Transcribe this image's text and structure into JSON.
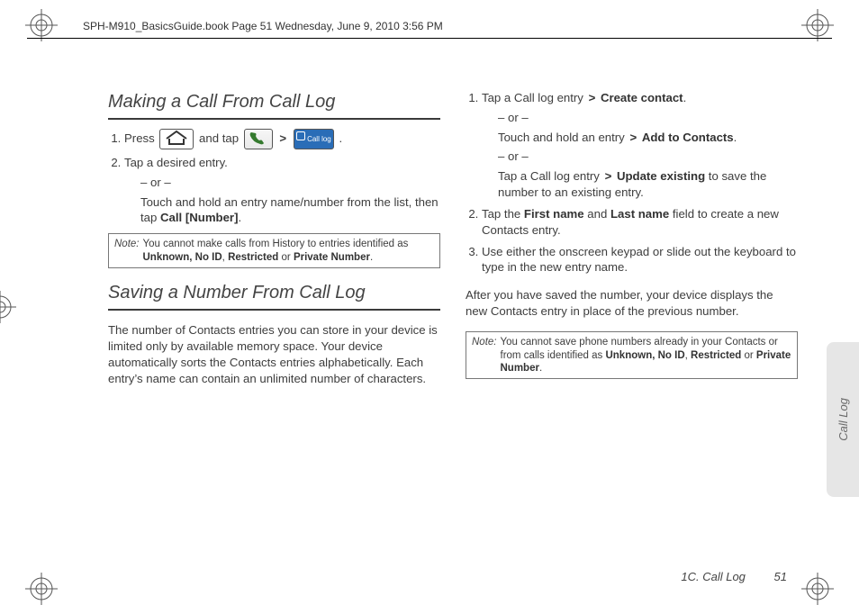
{
  "header": {
    "doc_stamp": "SPH-M910_BasicsGuide.book  Page 51  Wednesday, June 9, 2010  3:56 PM"
  },
  "left": {
    "h1": "Making a Call From Call Log",
    "step1_a": "Press ",
    "step1_b": " and tap ",
    "step1_dot": ".",
    "icon_home": "home-icon",
    "icon_phone": "phone-icon",
    "icon_calllog_label": "Call log",
    "step2": "Tap a desired entry.",
    "or": "– or –",
    "step2_or_body_a": "Touch and hold an entry name/number from the list, then tap ",
    "step2_or_body_b": "Call [Number]",
    "step2_or_body_c": ".",
    "note_label": "Note:",
    "note_a": "You cannot make calls from History to entries identified as ",
    "note_b": "Unknown, No ID",
    "note_c": ", ",
    "note_d": "Restricted",
    "note_e": " or ",
    "note_f": "Private Number",
    "note_g": ".",
    "h2": "Saving a Number From Call Log",
    "paragraph": "The number of Contacts entries you can store in your device is limited only by available memory space. Your device automatically sorts the Contacts entries alphabetically. Each entry’s name can contain an unlimited number of characters."
  },
  "right": {
    "s1a": "Tap a Call log entry ",
    "gt": ">",
    "s1b": "Create contact",
    "dot": ".",
    "or": "– or –",
    "s1c": "Touch and hold an entry ",
    "s1d": "Add to Contacts",
    "s1e": "Tap a Call log entry ",
    "s1f": "Update existing",
    "s1g": " to save the number to an existing entry.",
    "s2a": "Tap the ",
    "s2b": "First name",
    "s2c": " and ",
    "s2d": "Last name",
    "s2e": " field to create a new Contacts entry.",
    "s3": "Use either the onscreen keypad or slide out the keyboard to type in the new entry name.",
    "after": "After you have saved the number, your device displays the new Contacts entry in place of the previous number.",
    "note_label": "Note:",
    "note_a": "You cannot save phone numbers already in your Contacts or from calls identified as ",
    "note_b": "Unknown, No ID",
    "note_c": ", ",
    "note_d": "Restricted",
    "note_e": " or ",
    "note_f": "Private Number",
    "note_g": "."
  },
  "side_tab": "Call Log",
  "footer": {
    "section": "1C. Call Log",
    "page": "51"
  }
}
